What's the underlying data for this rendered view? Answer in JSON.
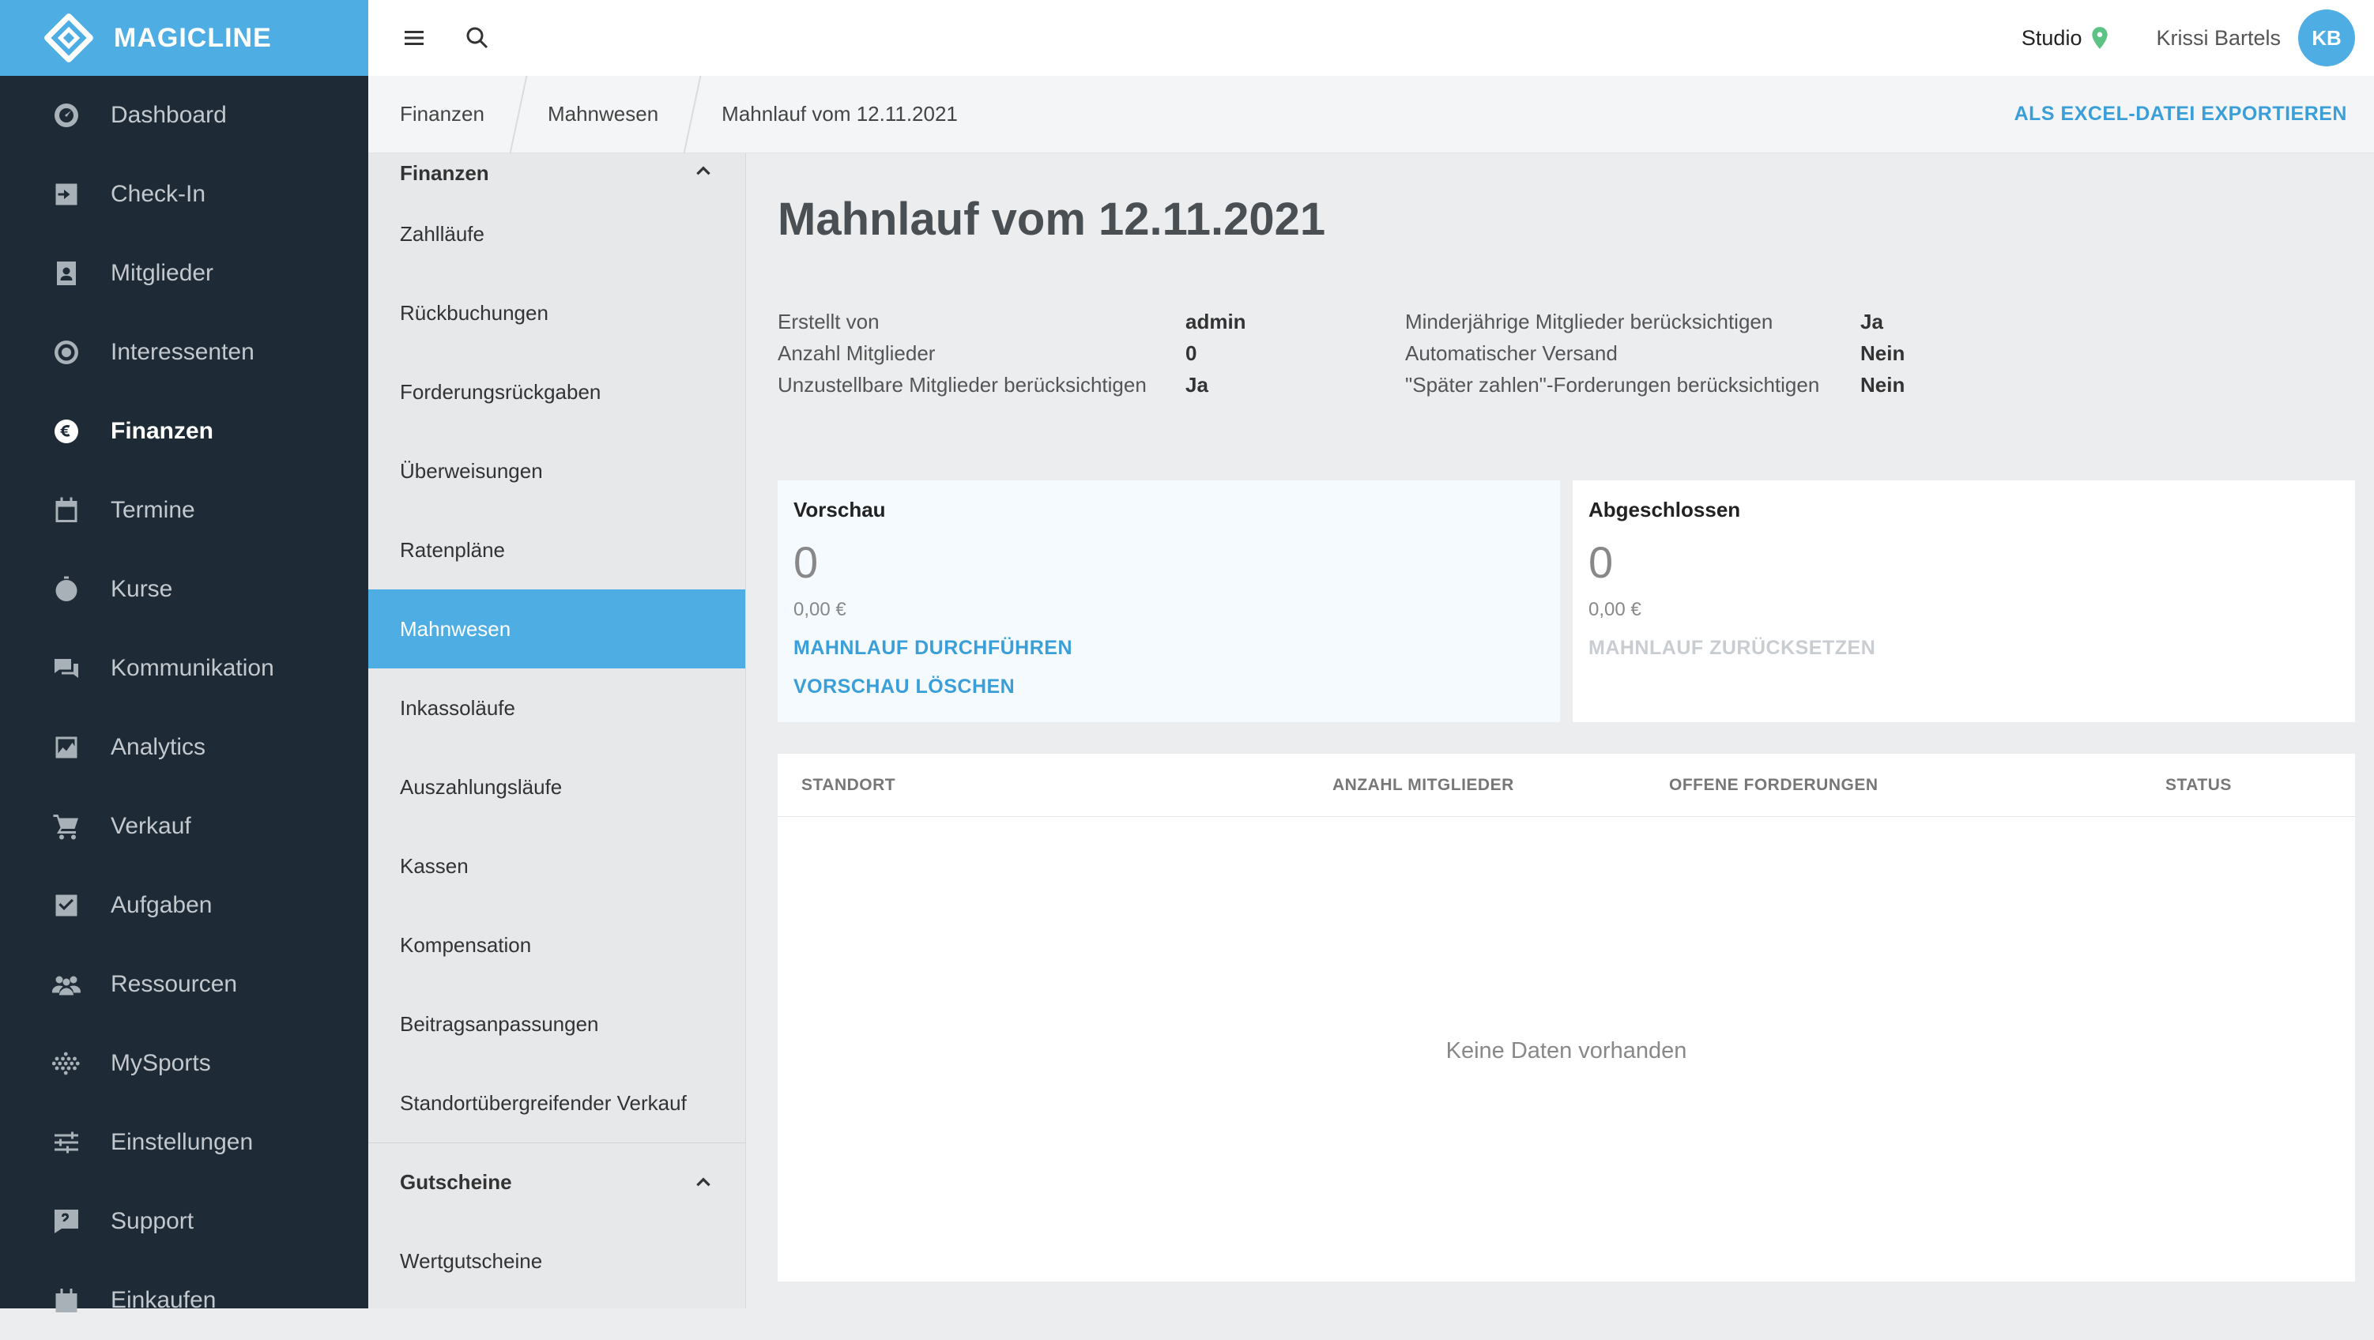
{
  "brand": {
    "name": "MAGICLINE"
  },
  "nav": {
    "items": [
      {
        "label": "Dashboard",
        "icon": "dashboard-icon"
      },
      {
        "label": "Check-In",
        "icon": "check-in-icon"
      },
      {
        "label": "Mitglieder",
        "icon": "members-icon"
      },
      {
        "label": "Interessenten",
        "icon": "prospects-icon"
      },
      {
        "label": "Finanzen",
        "icon": "euro-icon"
      },
      {
        "label": "Termine",
        "icon": "calendar-icon"
      },
      {
        "label": "Kurse",
        "icon": "stopwatch-icon"
      },
      {
        "label": "Kommunikation",
        "icon": "chat-icon"
      },
      {
        "label": "Analytics",
        "icon": "analytics-icon"
      },
      {
        "label": "Verkauf",
        "icon": "cart-icon"
      },
      {
        "label": "Aufgaben",
        "icon": "checkbox-icon"
      },
      {
        "label": "Ressourcen",
        "icon": "people-icon"
      },
      {
        "label": "MySports",
        "icon": "dots-grid-icon"
      },
      {
        "label": "Einstellungen",
        "icon": "sliders-icon"
      },
      {
        "label": "Support",
        "icon": "support-icon"
      },
      {
        "label": "Einkaufen",
        "icon": "shopping-icon"
      }
    ],
    "active_index": 4
  },
  "topbar": {
    "studio_label": "Studio",
    "user_name": "Krissi Bartels",
    "avatar_initials": "KB"
  },
  "breadcrumb": [
    "Finanzen",
    "Mahnwesen",
    "Mahnlauf vom 12.11.2021"
  ],
  "export_label": "ALS EXCEL-DATEI EXPORTIEREN",
  "submenu": {
    "section1": "Finanzen",
    "items": [
      "Zahlläufe",
      "Rückbuchungen",
      "Forderungsrückgaben",
      "Überweisungen",
      "Ratenpläne",
      "Mahnwesen",
      "Inkassoläufe",
      "Auszahlungsläufe",
      "Kassen",
      "Kompensation",
      "Beitragsanpassungen",
      "Standortübergreifender Verkauf"
    ],
    "active_index": 5,
    "section2": "Gutscheine",
    "section2_items": [
      "Wertgutscheine"
    ]
  },
  "page": {
    "title": "Mahnlauf vom 12.11.2021",
    "meta_left": [
      {
        "label": "Erstellt von",
        "value": "admin"
      },
      {
        "label": "Anzahl Mitglieder",
        "value": "0"
      },
      {
        "label": "Unzustellbare Mitglieder berücksichtigen",
        "value": "Ja"
      }
    ],
    "meta_right": [
      {
        "label": "Minderjährige Mitglieder berücksichtigen",
        "value": "Ja"
      },
      {
        "label": "Automatischer Versand",
        "value": "Nein"
      },
      {
        "label": "\"Später zahlen\"-Forderungen berücksichtigen",
        "value": "Nein"
      }
    ]
  },
  "cards": {
    "preview": {
      "title": "Vorschau",
      "count": "0",
      "amount": "0,00 €",
      "action1": "MAHNLAUF DURCHFÜHREN",
      "action2": "VORSCHAU LÖSCHEN"
    },
    "done": {
      "title": "Abgeschlossen",
      "count": "0",
      "amount": "0,00 €",
      "action1": "MAHNLAUF ZURÜCKSETZEN"
    }
  },
  "table": {
    "columns": [
      "STANDORT",
      "ANZAHL MITGLIEDER",
      "OFFENE FORDERUNGEN",
      "STATUS"
    ],
    "empty_text": "Keine Daten vorhanden"
  },
  "colors": {
    "accent": "#4eaee3",
    "link": "#3a9fd8",
    "nav_bg": "#1e2a35",
    "pin": "#5cc384"
  }
}
